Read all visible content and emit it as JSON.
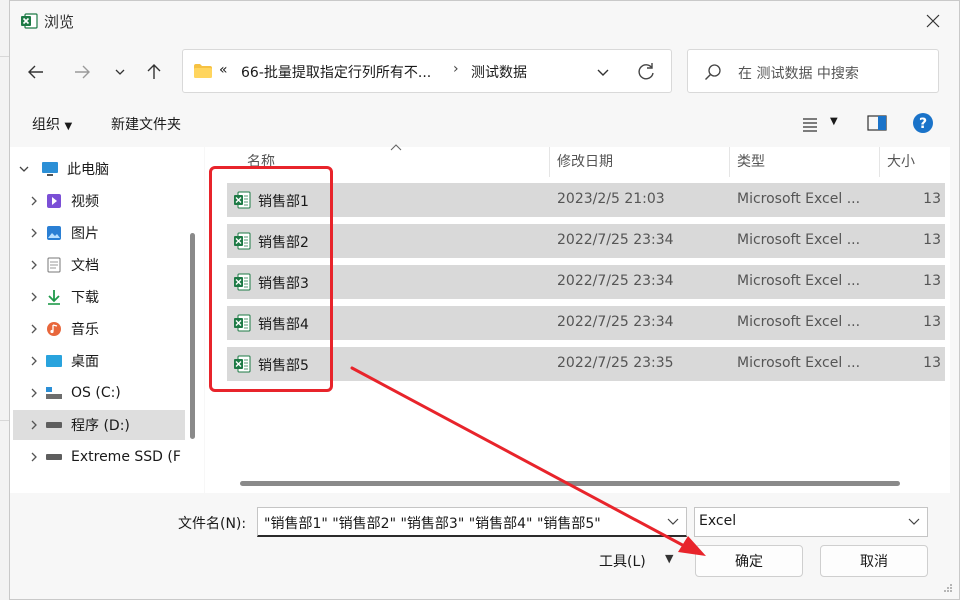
{
  "window": {
    "title": "浏览"
  },
  "nav": {
    "path_prefix": "«",
    "path": [
      "66-批量提取指定行列所有不...",
      "测试数据"
    ],
    "path_sep": "›",
    "search_placeholder": "在 测试数据 中搜索"
  },
  "toolbar": {
    "organize": "组织",
    "new_folder": "新建文件夹"
  },
  "sidebar": {
    "items": [
      {
        "label": "此电脑",
        "icon": "computer-icon",
        "expanded": true
      },
      {
        "label": "视频",
        "icon": "video-folder-icon"
      },
      {
        "label": "图片",
        "icon": "pictures-folder-icon"
      },
      {
        "label": "文档",
        "icon": "documents-folder-icon"
      },
      {
        "label": "下载",
        "icon": "download-folder-icon"
      },
      {
        "label": "音乐",
        "icon": "music-folder-icon"
      },
      {
        "label": "桌面",
        "icon": "desktop-folder-icon"
      },
      {
        "label": "OS (C:)",
        "icon": "system-drive-icon"
      },
      {
        "label": "程序 (D:)",
        "icon": "drive-icon",
        "selected": true
      },
      {
        "label": "Extreme SSD (F",
        "icon": "drive-icon"
      }
    ]
  },
  "columns": {
    "name": "名称",
    "date": "修改日期",
    "type": "类型",
    "size": "大小"
  },
  "files": [
    {
      "name": "销售部1",
      "date": "2023/2/5 21:03",
      "type": "Microsoft Excel ...",
      "size": "13"
    },
    {
      "name": "销售部2",
      "date": "2022/7/25 23:34",
      "type": "Microsoft Excel ...",
      "size": "13"
    },
    {
      "name": "销售部3",
      "date": "2022/7/25 23:34",
      "type": "Microsoft Excel ...",
      "size": "13"
    },
    {
      "name": "销售部4",
      "date": "2022/7/25 23:34",
      "type": "Microsoft Excel ...",
      "size": "13"
    },
    {
      "name": "销售部5",
      "date": "2022/7/25 23:35",
      "type": "Microsoft Excel ...",
      "size": "13"
    }
  ],
  "bottom": {
    "filename_label": "文件名(N):",
    "filename_value": "\"销售部1\" \"销售部2\" \"销售部3\" \"销售部4\" \"销售部5\"",
    "filetype_value": "Excel",
    "tools_label": "工具(L)",
    "ok_label": "确定",
    "cancel_label": "取消"
  },
  "colors": {
    "accent": "#e8242b",
    "excel_green": "#1d7a45",
    "help_blue": "#1a73c9",
    "selection": "#d9d9d9"
  }
}
